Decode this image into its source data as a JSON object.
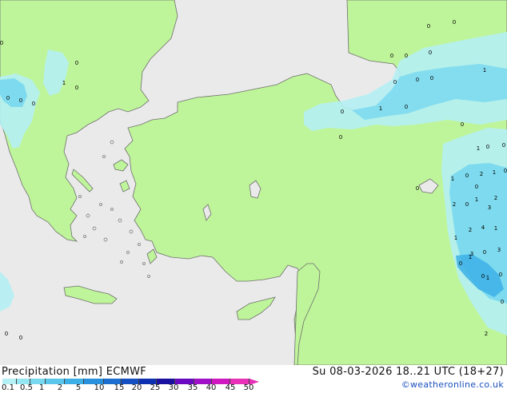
{
  "header": {
    "title": "Precipitation [mm]  ECMWF",
    "datetime": "Su 08-03-2026 18..21 UTC (18+27)",
    "credit": "©weatheronline.co.uk"
  },
  "legend": {
    "ticks": [
      "0.1",
      "0.5",
      "1",
      "2",
      "5",
      "10",
      "15",
      "20",
      "25",
      "30",
      "35",
      "40",
      "45",
      "50"
    ],
    "colors": [
      "#b4f0f4",
      "#96e6f2",
      "#78d8f0",
      "#5ac6ec",
      "#3cb0e6",
      "#2890dc",
      "#1c6ed0",
      "#1450c2",
      "#0c30b0",
      "#1a10a0",
      "#6a0ac0",
      "#a010c8",
      "#d018c0",
      "#e830b8"
    ]
  },
  "map": {
    "land_color": "#bff59a",
    "sea_color": "#eaeaea",
    "coast_color": "#6e6e6e",
    "values": [
      "0",
      "0",
      "0",
      "0",
      "0",
      "1",
      "0",
      "0",
      "0",
      "1",
      "0",
      "0",
      "0",
      "0",
      "0",
      "0",
      "0",
      "1",
      "0",
      "0",
      "0",
      "1",
      "0",
      "0",
      "0",
      "1",
      "2",
      "0",
      "1",
      "0",
      "2",
      "0",
      "2",
      "1",
      "4",
      "2",
      "1",
      "3",
      "3",
      "0",
      "0",
      "1",
      "0",
      "1",
      "0",
      "1",
      "0",
      "0",
      "0",
      "2",
      "3",
      "0"
    ]
  }
}
